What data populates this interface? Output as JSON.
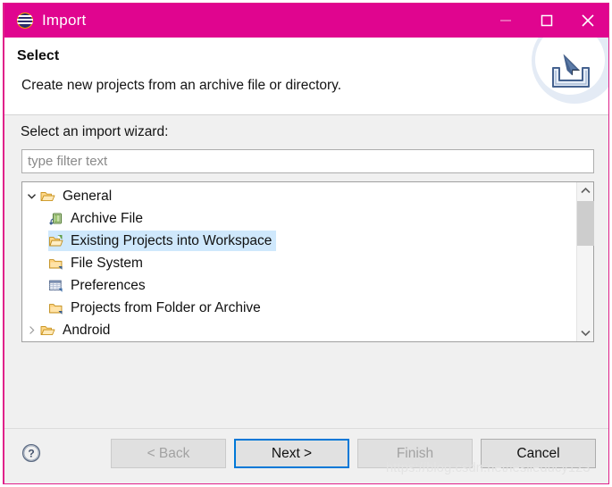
{
  "window": {
    "title": "Import",
    "icon": "eclipse-sphere-icon",
    "accent_color": "#e0058f",
    "controls": [
      {
        "name": "minimize",
        "glyph": "minimize-icon",
        "enabled": false
      },
      {
        "name": "maximize",
        "glyph": "maximize-icon",
        "enabled": true
      },
      {
        "name": "close",
        "glyph": "close-icon",
        "enabled": true
      }
    ]
  },
  "header": {
    "title": "Select",
    "description": "Create new projects from an archive file or directory.",
    "icon": "import-tray-arrow-icon"
  },
  "main": {
    "wizard_label": "Select an import wizard:",
    "filter": {
      "value": "",
      "placeholder": "type filter text"
    },
    "tree": [
      {
        "label": "General",
        "icon": "open-folder-icon",
        "level": 0,
        "twisty": "chevron-down-icon",
        "expanded": true,
        "selected": false
      },
      {
        "label": "Archive File",
        "icon": "archive-file-icon",
        "level": 1,
        "twisty": "",
        "expanded": false,
        "selected": false
      },
      {
        "label": "Existing Projects into Workspace",
        "icon": "import-folder-icon",
        "level": 1,
        "twisty": "",
        "expanded": false,
        "selected": true
      },
      {
        "label": "File System",
        "icon": "folder-icon",
        "level": 1,
        "twisty": "",
        "expanded": false,
        "selected": false
      },
      {
        "label": "Preferences",
        "icon": "preferences-icon",
        "level": 1,
        "twisty": "",
        "expanded": false,
        "selected": false
      },
      {
        "label": "Projects from Folder or Archive",
        "icon": "folder-icon",
        "level": 1,
        "twisty": "",
        "expanded": false,
        "selected": false
      },
      {
        "label": "Android",
        "icon": "open-folder-icon",
        "level": 0,
        "twisty": "chevron-right-icon",
        "expanded": false,
        "selected": false
      }
    ],
    "scrollbar": {
      "up_icon": "chevron-up-icon",
      "down_icon": "chevron-down-icon",
      "thumb_position": "top"
    },
    "selection_color": "#cfe8fc"
  },
  "footer": {
    "help_icon": "help-question-icon",
    "buttons": [
      {
        "label": "< Back",
        "state": "disabled",
        "name": "back-button"
      },
      {
        "label": "Next >",
        "state": "focused",
        "name": "next-button"
      },
      {
        "label": "Finish",
        "state": "disabled",
        "name": "finish-button"
      },
      {
        "label": "Cancel",
        "state": "enabled",
        "name": "cancel-button"
      }
    ],
    "focus_color": "#0078d7"
  },
  "watermark": "https://blog.csdn.net/leslieducy123"
}
